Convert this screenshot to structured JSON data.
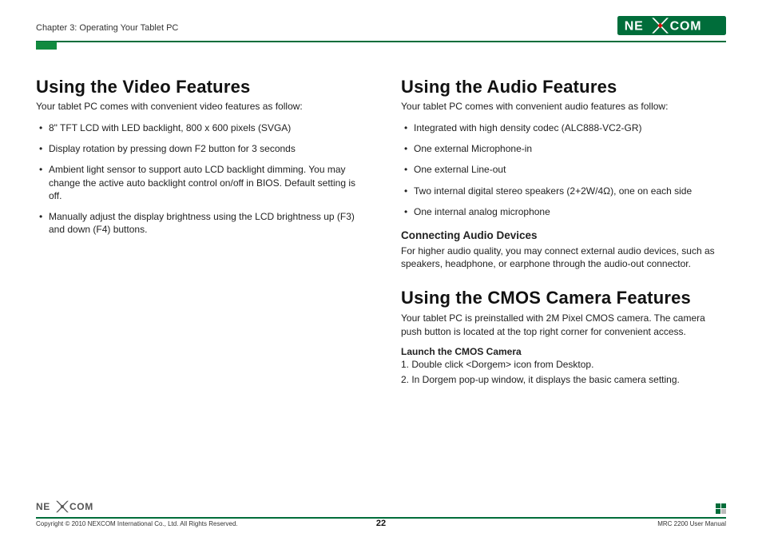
{
  "header": {
    "chapter": "Chapter 3: Operating Your Tablet PC",
    "brand_left": "NE",
    "brand_right": "COM"
  },
  "left": {
    "title": "Using the Video Features",
    "lead": "Your tablet PC comes with convenient video features as follow:",
    "bullets": [
      "8\" TFT LCD with LED backlight, 800 x 600 pixels (SVGA)",
      "Display rotation by pressing down F2 button for 3 seconds",
      "Ambient light sensor to support auto LCD backlight dimming. You may change the active auto backlight control on/off in BIOS. Default setting is off.",
      " Manually adjust the display brightness using the LCD brightness up (F3) and down (F4) buttons."
    ]
  },
  "right": {
    "audio": {
      "title": "Using the Audio Features",
      "lead": "Your tablet PC comes with convenient audio features as follow:",
      "bullets": [
        "Integrated with high density codec (ALC888-VC2-GR)",
        "One external Microphone-in",
        "One external Line-out",
        "Two internal digital stereo speakers (2+2W/4Ω), one on each side",
        "One internal analog microphone"
      ],
      "sub_title": "Connecting Audio Devices",
      "sub_body": "For higher audio quality, you may connect external audio devices, such as speakers, headphone, or earphone through the audio-out connector."
    },
    "cmos": {
      "title": "Using the CMOS Camera Features",
      "lead": "Your tablet PC is preinstalled with 2M Pixel CMOS camera. The camera push button is located at the top right corner for convenient access.",
      "launch_label": "Launch the CMOS Camera",
      "steps": [
        "1. Double click <Dorgem> icon from Desktop.",
        "2. In Dorgem pop-up window, it displays the basic camera setting."
      ]
    }
  },
  "footer": {
    "copyright": "Copyright © 2010 NEXCOM International Co., Ltd. All Rights Reserved.",
    "page": "22",
    "doc": "MRC 2200 User Manual"
  }
}
